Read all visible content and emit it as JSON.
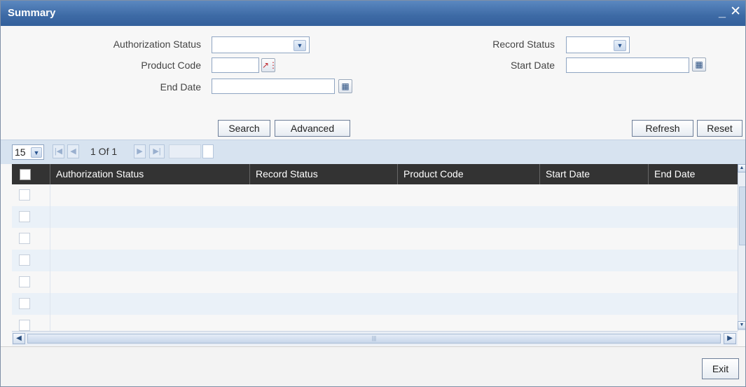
{
  "window": {
    "title": "Summary",
    "minimize_glyph": "_",
    "close_glyph": "✕"
  },
  "filters": {
    "authorization_status": {
      "label": "Authorization Status",
      "value": ""
    },
    "record_status": {
      "label": "Record Status",
      "value": ""
    },
    "product_code": {
      "label": "Product Code",
      "value": ""
    },
    "start_date": {
      "label": "Start Date",
      "value": ""
    },
    "end_date": {
      "label": "End Date",
      "value": ""
    }
  },
  "buttons": {
    "search": "Search",
    "advanced": "Advanced",
    "refresh": "Refresh",
    "reset": "Reset",
    "exit": "Exit"
  },
  "pager": {
    "page_size": "15",
    "page_text": "1 Of 1",
    "goto_value": ""
  },
  "grid": {
    "columns": [
      "Authorization Status",
      "Record Status",
      "Product Code",
      "Start Date",
      "End Date"
    ],
    "rows": [
      {},
      {},
      {},
      {},
      {},
      {},
      {}
    ]
  },
  "icons": {
    "lov": "lov-search-icon",
    "calendar": "calendar-icon",
    "dropdown": "chevron-down-icon",
    "first": "first-page-icon",
    "prev": "prev-page-icon",
    "next": "next-page-icon",
    "last": "last-page-icon"
  },
  "colors": {
    "titlebar": "#3d6aa5",
    "grid_header": "#333333",
    "row_alt": "#eaf1f8",
    "pager_bar": "#d7e3f0"
  }
}
